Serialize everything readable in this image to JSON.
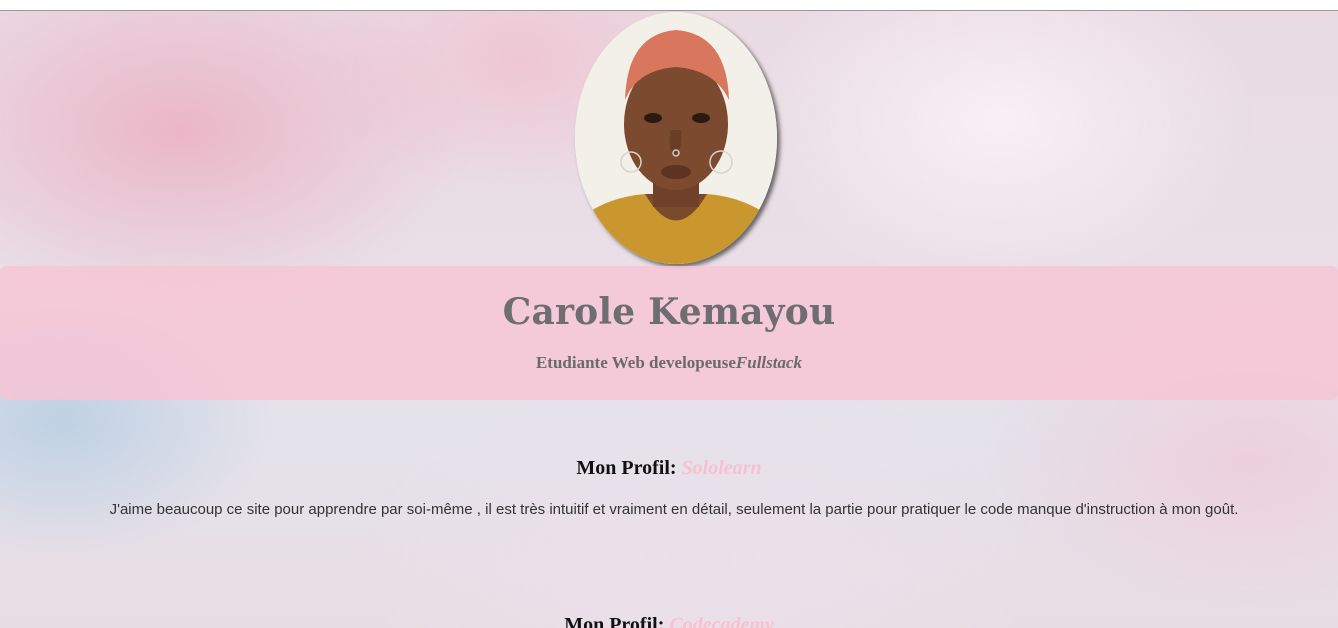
{
  "profile": {
    "name": "Carole Kemayou",
    "subtitle_main": "Etudiante Web developeuse",
    "subtitle_emphasis": "Fullstack"
  },
  "sections": [
    {
      "heading_label": "Mon Profil:",
      "site": "Sololearn",
      "text": "J'aime beaucoup ce site pour apprendre par soi-même , il est très intuitif et vraiment en détail, seulement la partie pour pratiquer le code manque d'instruction à mon goût."
    },
    {
      "heading_label": "Mon Profil:",
      "site": "Codecademy"
    }
  ],
  "colors": {
    "banner": "#f8c4d4",
    "accent_link": "#f7c2d0",
    "name_text": "#6e6e70"
  }
}
